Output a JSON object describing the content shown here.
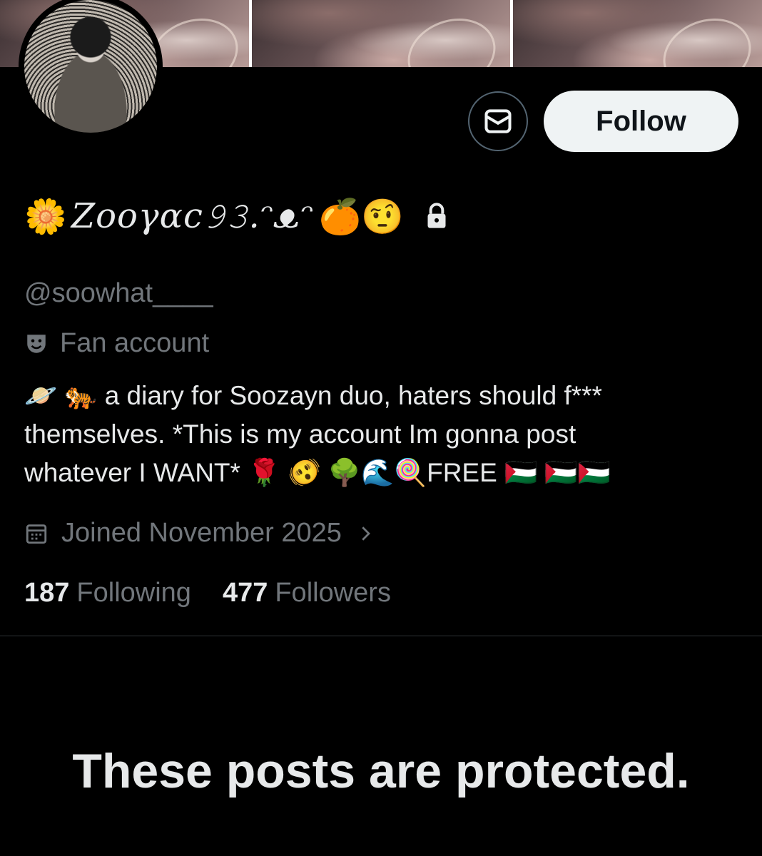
{
  "profile": {
    "display_name_prefix": "🌼",
    "display_name": "Zooγαc𝟿𝟹.ᵔᴥᵔ",
    "display_name_suffix": "🍊🤨",
    "handle": "@soowhat____",
    "category": "Fan account",
    "bio_lines": [
      "🪐 🐅 a diary for Soozayn duo, haters should f***",
      "themselves. *This is my account Im gonna post",
      "whatever I WANT* 🌹 🫨 🌳🌊🍭FREE 🇵🇸 🇵🇸🇵🇸"
    ],
    "joined": "Joined November 2025",
    "following_count": "187",
    "following_label": "Following",
    "followers_count": "477",
    "followers_label": "Followers"
  },
  "actions": {
    "follow_label": "Follow"
  },
  "protected_message": "These posts are protected."
}
